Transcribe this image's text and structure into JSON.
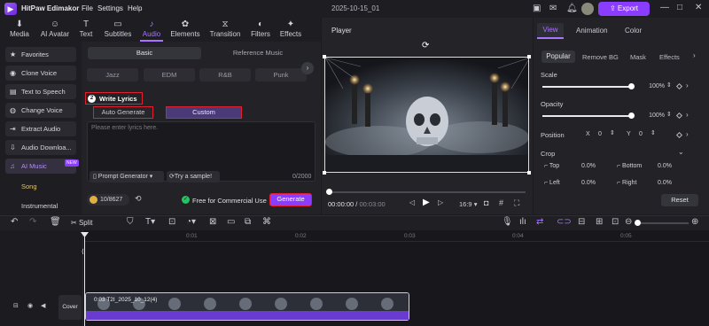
{
  "app": {
    "title": "HitPaw Edimakor",
    "menu": [
      "File",
      "Settings",
      "Help"
    ],
    "project_name": "2025-10-15_01",
    "export_label": "Export"
  },
  "toolbar": {
    "items": [
      {
        "label": "Media",
        "icon": "media-icon"
      },
      {
        "label": "AI Avatar",
        "icon": "ai-avatar-icon"
      },
      {
        "label": "Text",
        "icon": "text-icon"
      },
      {
        "label": "Subtitles",
        "icon": "subtitles-icon"
      },
      {
        "label": "Audio",
        "icon": "music-note-icon",
        "active": true
      },
      {
        "label": "Elements",
        "icon": "elements-icon"
      },
      {
        "label": "Transition",
        "icon": "transition-icon"
      },
      {
        "label": "Filters",
        "icon": "filters-icon"
      },
      {
        "label": "Effects",
        "icon": "effects-icon"
      }
    ]
  },
  "sidebar": {
    "items": [
      {
        "label": "Favorites"
      },
      {
        "label": "Clone Voice"
      },
      {
        "label": "Text to Speech"
      },
      {
        "label": "Change Voice"
      },
      {
        "label": "Extract Audio"
      },
      {
        "label": "Audio Downloa..."
      },
      {
        "label": "AI Music",
        "active": true,
        "badge": "NEW"
      }
    ],
    "sub_items": [
      {
        "label": "Song",
        "active": true
      },
      {
        "label": "Instrumental"
      }
    ]
  },
  "music_panel": {
    "tabs": [
      "Basic",
      "Reference Music"
    ],
    "genres": [
      "Jazz",
      "EDM",
      "R&B",
      "Punk"
    ],
    "step_number": "2",
    "write_lyrics_label": "Write Lyrics",
    "mode_auto": "Auto Generate",
    "mode_custom": "Custom",
    "lyrics_placeholder": "Please enter lyrics here.",
    "prompt_generator": "Prompt Generator",
    "try_sample": "Try a sample!",
    "char_count": "0/2000",
    "credits": "10/8627",
    "free_commercial": "Free for Commercial Use",
    "generate_label": "Generate"
  },
  "player": {
    "title": "Player",
    "current_time": "00:00:00",
    "total_time": "00:03:00",
    "aspect_ratio": "16:9"
  },
  "right_panel": {
    "tabs": [
      "View",
      "Animation",
      "Color"
    ],
    "subtabs": [
      "Popular",
      "Remove BG",
      "Mask",
      "Effects"
    ],
    "scale_label": "Scale",
    "scale_value": "100%",
    "scale_fraction": 1.0,
    "opacity_label": "Opacity",
    "opacity_value": "100%",
    "opacity_fraction": 1.0,
    "position_label": "Position",
    "pos_x_label": "X",
    "pos_x_value": "0",
    "pos_y_label": "Y",
    "pos_y_value": "0",
    "crop_label": "Crop",
    "crop_top_label": "Top",
    "crop_top_value": "0.0%",
    "crop_bottom_label": "Bottom",
    "crop_bottom_value": "0.0%",
    "crop_left_label": "Left",
    "crop_left_value": "0.0%",
    "crop_right_label": "Right",
    "crop_right_value": "0.0%",
    "reset_label": "Reset"
  },
  "timeline": {
    "split_label": "Split",
    "ruler": [
      "0:01",
      "0:02",
      "0:03",
      "0:04",
      "0:05"
    ],
    "cover_label": "Cover",
    "clip_label": "0:03  T2I_2025_10_12(4)"
  },
  "colors": {
    "accent": "#8b3dff",
    "accent_light": "#a974ff",
    "highlight_box": "#e0202e"
  }
}
